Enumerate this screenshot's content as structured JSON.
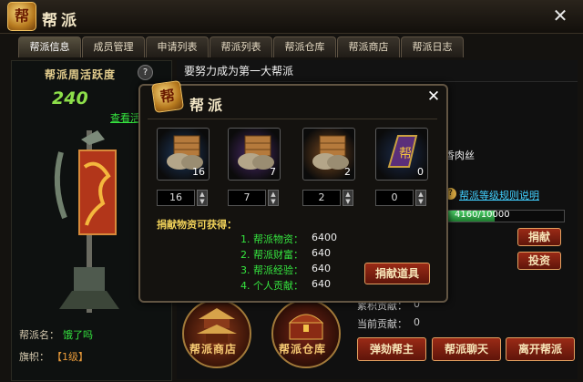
{
  "window": {
    "title": "帮派",
    "emblem_glyph": "帮"
  },
  "tabs": [
    {
      "label": "帮派信息",
      "active": true
    },
    {
      "label": "成员管理"
    },
    {
      "label": "申请列表"
    },
    {
      "label": "帮派列表"
    },
    {
      "label": "帮派仓库"
    },
    {
      "label": "帮派商店"
    },
    {
      "label": "帮派日志"
    }
  ],
  "left": {
    "weekly_title": "帮派周活跃度",
    "weekly_value": "240",
    "help_glyph": "?",
    "view_link": "查看活",
    "name_label": "帮派名：",
    "name_value": "饿了吗",
    "flag_label": "旗帜：",
    "flag_value": "【1级】"
  },
  "main": {
    "motto": "要努力成为第一大帮派",
    "partial_text": "香肉丝",
    "rules_link": "帮派等级规则说明",
    "progress": {
      "text": "4160/10000",
      "current": 4160,
      "max": 10000
    },
    "donate_btn": "捐献",
    "invest_btn": "投资",
    "total_contrib_label": "累积贡献：",
    "total_contrib_value": "0",
    "current_contrib_label": "当前贡献：",
    "current_contrib_value": "0",
    "impeach_btn": "弹劾帮主",
    "chat_btn": "帮派聊天",
    "leave_btn": "离开帮派",
    "shop_label": "帮派商店",
    "warehouse_label": "帮派仓库"
  },
  "dialog": {
    "title": "帮派",
    "items": [
      {
        "icon": "wooden-crate-icon",
        "qty": "16",
        "input": "16",
        "frame": "#1f3a5f"
      },
      {
        "icon": "wooden-crate-icon",
        "qty": "7",
        "input": "7",
        "frame": "#4a2a6a"
      },
      {
        "icon": "wooden-crate-icon",
        "qty": "2",
        "input": "2",
        "frame": "#7a4a20"
      },
      {
        "icon": "dragon-badge-icon",
        "qty": "0",
        "input": "0",
        "frame": "#1c2c4c"
      }
    ],
    "rewards_title": "捐献物资可获得：",
    "rewards": [
      {
        "label": "1. 帮派物资：",
        "value": "6400"
      },
      {
        "label": "2. 帮派财富：",
        "value": "640"
      },
      {
        "label": "3. 帮派经验：",
        "value": "640"
      },
      {
        "label": "4. 个人贡献：",
        "value": "640"
      }
    ],
    "donate_items_btn": "捐献道具"
  }
}
